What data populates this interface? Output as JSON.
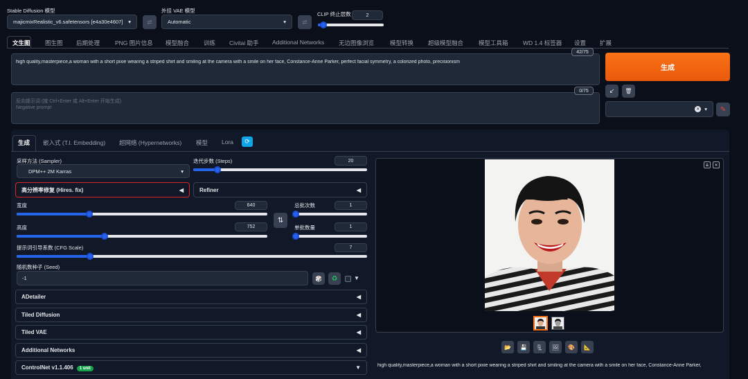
{
  "model": {
    "label": "Stable Diffusion 模型",
    "value": "majicmixRealistic_v6.safetensors [e4a30e4607]"
  },
  "vae": {
    "label": "外挂 VAE 模型",
    "value": "Automatic"
  },
  "clip": {
    "label": "CLIP 终止层数",
    "value": "2",
    "fraction": 0.08
  },
  "tabs": [
    "文生图",
    "图生图",
    "后期处理",
    "PNG 图片信息",
    "模型融合",
    "训练",
    "Civitai 助手",
    "Additional Networks",
    "无边图像浏览",
    "模型转换",
    "超级模型融合",
    "模型工具箱",
    "WD 1.4 标签器",
    "设置",
    "扩展"
  ],
  "prompt": {
    "text": "high quality,masterpiece,a woman with a short pixie wearing a striped shirt and smiling at the camera with a smile on her face, Constance-Anne Parker, perfect facial symmetry, a colorized photo, precisionism",
    "counter": "42/75"
  },
  "negative": {
    "placeholder1": "反向提示词 (按 Ctrl+Enter 或 Alt+Enter 开始生成)",
    "placeholder2": "Negative prompt",
    "counter": "0/75"
  },
  "generate_label": "生成",
  "icons": {
    "arrow": "↙",
    "trash": "🗑",
    "clear": "✕",
    "caret": "▾",
    "brush": "🖌",
    "swap": "⇅",
    "dice": "🎲",
    "recycle": "♻",
    "refresh": "⟳"
  },
  "subtabs": [
    "生成",
    "嵌入式 (T.I. Embedding)",
    "超网络 (Hypernetworks)",
    "模型",
    "Lora"
  ],
  "sampler": {
    "label": "采样方法 (Sampler)",
    "value": "DPM++ 2M Karras"
  },
  "steps": {
    "label": "迭代步数 (Steps)",
    "value": "20",
    "fraction": 0.14
  },
  "hires": {
    "label": "高分辨率修复 (Hires. fix)",
    "arrow": "◀"
  },
  "refiner": {
    "label": "Refiner",
    "arrow": "◀"
  },
  "width": {
    "label": "宽度",
    "value": "640",
    "fraction": 0.29
  },
  "height": {
    "label": "高度",
    "value": "752",
    "fraction": 0.35
  },
  "batch_count": {
    "label": "总批次数",
    "value": "1",
    "fraction": 0.02
  },
  "batch_size": {
    "label": "单批数量",
    "value": "1",
    "fraction": 0.02
  },
  "cfg": {
    "label": "提示词引导系数 (CFG Scale)",
    "value": "7",
    "fraction": 0.21
  },
  "seed": {
    "label": "随机数种子 (Seed)",
    "value": "-1",
    "extra_arrow": "▼"
  },
  "accordions": [
    {
      "label": "ADetailer",
      "arrow": "◀"
    },
    {
      "label": "Tiled Diffusion",
      "arrow": "◀"
    },
    {
      "label": "Tiled VAE",
      "arrow": "◀"
    },
    {
      "label": "Additional Networks",
      "arrow": "◀"
    },
    {
      "label": "ControlNet v1.1.406",
      "badge": "1 unit",
      "arrow": "▼"
    }
  ],
  "output": {
    "caption": "high quality,masterpiece,a woman with a short pixie wearing a striped shirt and smiling at the camera with a smile on her face, Constance-Anne Parker,",
    "tools": [
      "folder",
      "save",
      "zip",
      "image",
      "palette",
      "triangle"
    ]
  },
  "colors": {
    "accent": "#f97316",
    "highlight": "#dc2626",
    "badge": "#16a34a",
    "slider": "#2563eb"
  }
}
